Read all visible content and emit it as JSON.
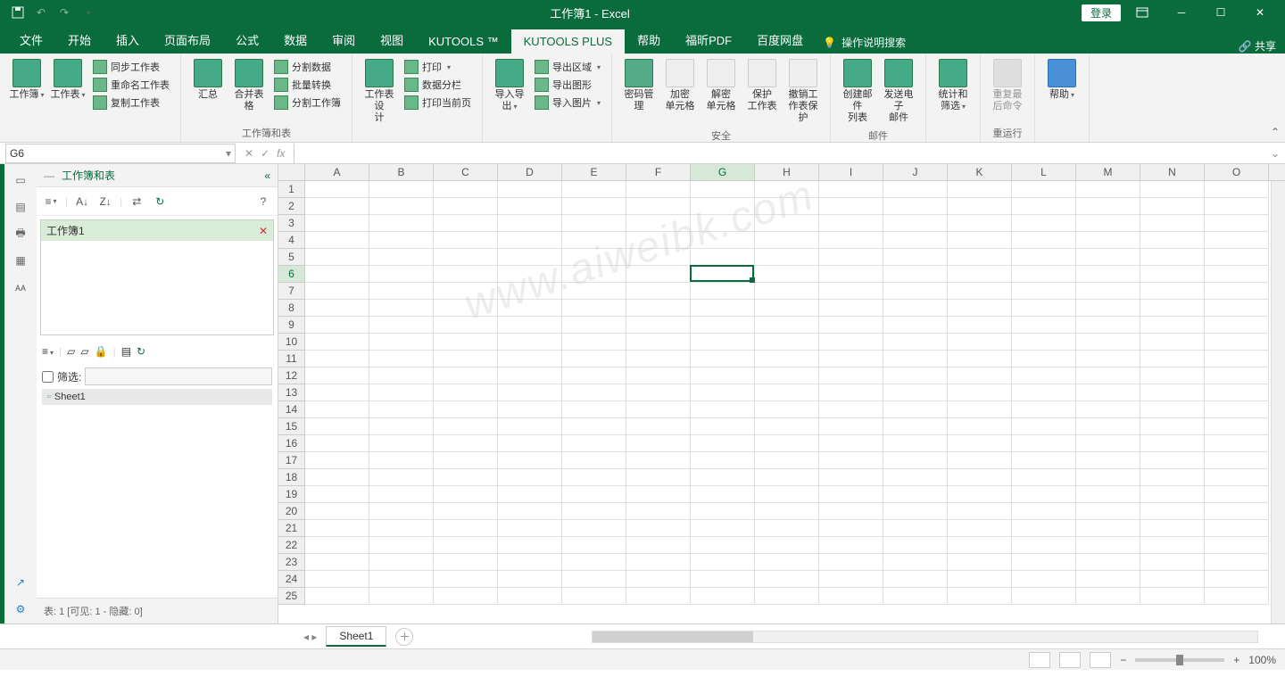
{
  "title": "工作簿1 - Excel",
  "login": "登录",
  "tabs": [
    "文件",
    "开始",
    "插入",
    "页面布局",
    "公式",
    "数据",
    "审阅",
    "视图",
    "KUTOOLS ™",
    "KUTOOLS PLUS",
    "帮助",
    "福昕PDF",
    "百度网盘"
  ],
  "active_tab": "KUTOOLS PLUS",
  "search_hint": "操作说明搜索",
  "share": "共享",
  "ribbon": {
    "g1": {
      "big": [
        {
          "l": "工作簿"
        },
        {
          "l": "工作表"
        }
      ],
      "small": [
        "同步工作表",
        "重命名工作表",
        "复制工作表"
      ],
      "label": ""
    },
    "g2": {
      "big": [
        {
          "l": "汇总"
        },
        {
          "l": "合并表格"
        }
      ],
      "small": [
        "分割数据",
        "批量转换",
        "分割工作簿"
      ],
      "label": "工作簿和表"
    },
    "g3": {
      "big": [
        {
          "l": "工作表设\n计"
        }
      ],
      "small": [
        "打印",
        "数据分栏",
        "打印当前页"
      ],
      "label": ""
    },
    "g4": {
      "big": [
        {
          "l": "导入导出"
        }
      ],
      "small": [
        "导出区域",
        "导出图形",
        "导入图片"
      ],
      "label": ""
    },
    "g5": {
      "big": [
        {
          "l": "密码管理"
        },
        {
          "l": "加密\n单元格"
        },
        {
          "l": "解密\n单元格"
        },
        {
          "l": "保护\n工作表"
        },
        {
          "l": "撤销工\n作表保护"
        }
      ],
      "label": "安全"
    },
    "g6": {
      "big": [
        {
          "l": "创建邮件\n列表"
        },
        {
          "l": "发送电子\n邮件"
        }
      ],
      "label": "邮件"
    },
    "g7": {
      "big": [
        {
          "l": "统计和\n筛选"
        }
      ],
      "label": ""
    },
    "g8": {
      "big": [
        {
          "l": "重复最\n后命令"
        }
      ],
      "label": "重运行"
    },
    "g9": {
      "big": [
        {
          "l": "帮助"
        }
      ],
      "label": ""
    }
  },
  "namebox": "G6",
  "sidepanel": {
    "title": "工作簿和表",
    "workbook": "工作簿1",
    "filter_label": "筛选:",
    "sheet": "Sheet1",
    "status": "表: 1 [可见: 1 - 隐藏: 0]"
  },
  "columns": [
    "A",
    "B",
    "C",
    "D",
    "E",
    "F",
    "G",
    "H",
    "I",
    "J",
    "K",
    "L",
    "M",
    "N",
    "O"
  ],
  "rows": 25,
  "selected": {
    "col": "G",
    "row": 6,
    "colIdx": 6,
    "rowIdx": 5
  },
  "sheet_tab": "Sheet1",
  "zoom": "100%",
  "watermark": "www.aiweibk.com"
}
